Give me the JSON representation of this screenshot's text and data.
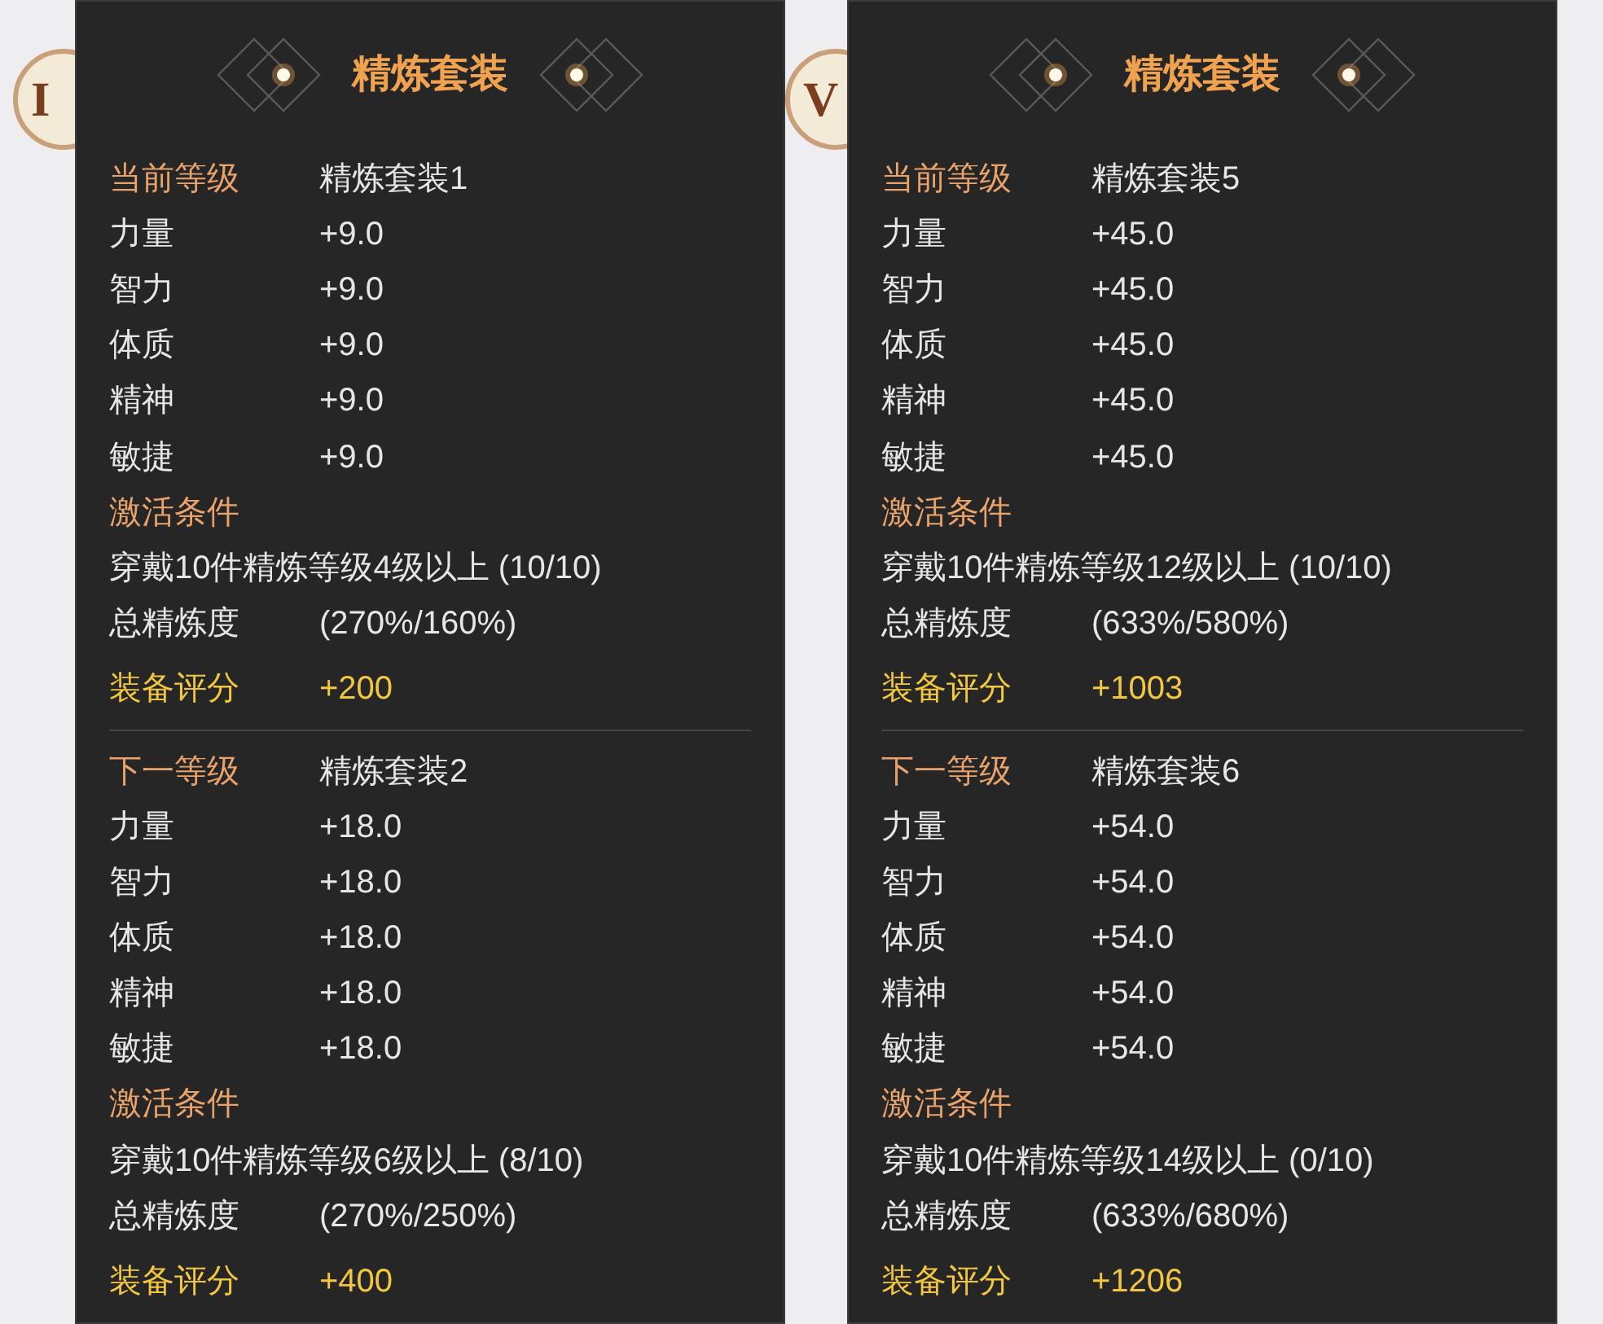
{
  "background_badges": [
    {
      "label": "I"
    },
    {
      "label": "V"
    }
  ],
  "panels": [
    {
      "title": "精炼套装",
      "sections": [
        {
          "rows": [
            {
              "kind": "level",
              "label": "当前等级",
              "value": "精炼套装1"
            },
            {
              "kind": "stat",
              "label": "力量",
              "value": "+9.0"
            },
            {
              "kind": "stat",
              "label": "智力",
              "value": "+9.0"
            },
            {
              "kind": "stat",
              "label": "体质",
              "value": "+9.0"
            },
            {
              "kind": "stat",
              "label": "精神",
              "value": "+9.0"
            },
            {
              "kind": "stat",
              "label": "敏捷",
              "value": "+9.0"
            },
            {
              "kind": "heading",
              "label": "激活条件"
            },
            {
              "kind": "text",
              "label": "穿戴10件精炼等级4级以上 (10/10)"
            },
            {
              "kind": "stat",
              "label": "总精炼度",
              "value": "(270%/160%)"
            },
            {
              "kind": "score",
              "label": "装备评分",
              "value": "+200"
            }
          ]
        },
        {
          "rows": [
            {
              "kind": "level",
              "label": "下一等级",
              "value": "精炼套装2"
            },
            {
              "kind": "stat",
              "label": "力量",
              "value": "+18.0"
            },
            {
              "kind": "stat",
              "label": "智力",
              "value": "+18.0"
            },
            {
              "kind": "stat",
              "label": "体质",
              "value": "+18.0"
            },
            {
              "kind": "stat",
              "label": "精神",
              "value": "+18.0"
            },
            {
              "kind": "stat",
              "label": "敏捷",
              "value": "+18.0"
            },
            {
              "kind": "heading",
              "label": "激活条件"
            },
            {
              "kind": "text",
              "label": "穿戴10件精炼等级6级以上 (8/10)"
            },
            {
              "kind": "stat",
              "label": "总精炼度",
              "value": "(270%/250%)"
            },
            {
              "kind": "score",
              "label": "装备评分",
              "value": "+400"
            }
          ]
        }
      ]
    },
    {
      "title": "精炼套装",
      "sections": [
        {
          "rows": [
            {
              "kind": "level",
              "label": "当前等级",
              "value": "精炼套装5"
            },
            {
              "kind": "stat",
              "label": "力量",
              "value": "+45.0"
            },
            {
              "kind": "stat",
              "label": "智力",
              "value": "+45.0"
            },
            {
              "kind": "stat",
              "label": "体质",
              "value": "+45.0"
            },
            {
              "kind": "stat",
              "label": "精神",
              "value": "+45.0"
            },
            {
              "kind": "stat",
              "label": "敏捷",
              "value": "+45.0"
            },
            {
              "kind": "heading",
              "label": "激活条件"
            },
            {
              "kind": "text",
              "label": "穿戴10件精炼等级12级以上 (10/10)"
            },
            {
              "kind": "stat",
              "label": "总精炼度",
              "value": "(633%/580%)"
            },
            {
              "kind": "score",
              "label": "装备评分",
              "value": "+1003"
            }
          ]
        },
        {
          "rows": [
            {
              "kind": "level",
              "label": "下一等级",
              "value": "精炼套装6"
            },
            {
              "kind": "stat",
              "label": "力量",
              "value": "+54.0"
            },
            {
              "kind": "stat",
              "label": "智力",
              "value": "+54.0"
            },
            {
              "kind": "stat",
              "label": "体质",
              "value": "+54.0"
            },
            {
              "kind": "stat",
              "label": "精神",
              "value": "+54.0"
            },
            {
              "kind": "stat",
              "label": "敏捷",
              "value": "+54.0"
            },
            {
              "kind": "heading",
              "label": "激活条件"
            },
            {
              "kind": "text",
              "label": "穿戴10件精炼等级14级以上 (0/10)"
            },
            {
              "kind": "stat",
              "label": "总精炼度",
              "value": "(633%/680%)"
            },
            {
              "kind": "score",
              "label": "装备评分",
              "value": "+1206"
            }
          ]
        }
      ]
    }
  ]
}
